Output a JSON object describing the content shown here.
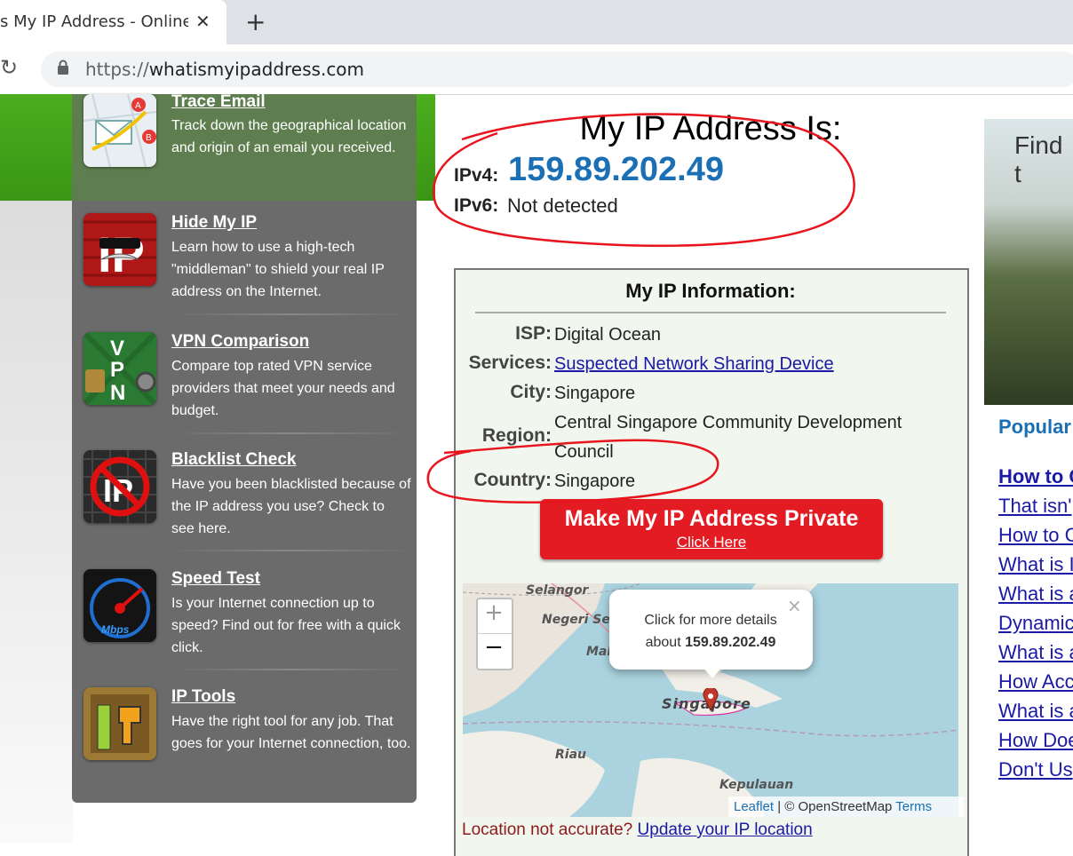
{
  "browser": {
    "tab_title": "s My IP Address - Online P",
    "url_prefix": "https://",
    "url_domain": "whatismyipaddress.com",
    "new_tab_symbol": "+",
    "close_symbol": "✕",
    "reload_symbol": "↻"
  },
  "sidebar": {
    "items": [
      {
        "title": "Trace Email",
        "desc": "Track down the geographical location and origin of an email you received."
      },
      {
        "title": "Hide My IP",
        "desc": "Learn how to use a high-tech \"middleman\" to shield your real IP address on the Internet."
      },
      {
        "title": "VPN Comparison",
        "desc": "Compare top rated VPN service providers that meet your needs and budget."
      },
      {
        "title": "Blacklist Check",
        "desc": "Have you been blacklisted because of the IP address you use? Check to see here."
      },
      {
        "title": "Speed Test",
        "desc": "Is your Internet connection up to speed? Find out for free with a quick click."
      },
      {
        "title": "IP Tools",
        "desc": "Have the right tool for any job. That goes for your Internet connection, too."
      }
    ]
  },
  "main": {
    "title": "My IP Address Is:",
    "ipv4_label": "IPv4:",
    "ipv4_value": "159.89.202.49",
    "ipv6_label": "IPv6:",
    "ipv6_value": "Not detected"
  },
  "info": {
    "title": "My IP Information:",
    "isp_label": "ISP:",
    "isp_value": "Digital Ocean",
    "services_label": "Services:",
    "services_value": "Suspected Network Sharing Device",
    "city_label": "City:",
    "city_value": "Singapore",
    "region_label": "Region:",
    "region_value_line1": "Central Singapore Community Development",
    "region_value_line2": "Council",
    "country_label": "Country:",
    "country_value": "Singapore"
  },
  "private_button": {
    "label": "Make My IP Address Private",
    "sub": "Click Here"
  },
  "map": {
    "zoom_in": "+",
    "zoom_out": "−",
    "popup_line1": "Click for more details",
    "popup_line2_prefix": "about ",
    "popup_ip": "159.89.202.49",
    "popup_close": "×",
    "labels": {
      "selangor": "Selangor",
      "negeri": "Negeri Sem",
      "mal": "Mal",
      "singapore": "Singapore",
      "riau": "Riau",
      "kepulauan": "Kepulauan"
    },
    "attrib_leaflet": "Leaflet",
    "attrib_middle": " | © OpenStreetMap ",
    "attrib_terms": "Terms"
  },
  "location_note": {
    "text": "Location not accurate? ",
    "link": "Update your IP location"
  },
  "ad": {
    "text": "Find t"
  },
  "popular": {
    "title": "Popular",
    "items": [
      "How to C",
      "That isn'",
      "How to C",
      "What is I",
      "What is a",
      "Dynamic",
      "What is a",
      "How Acc",
      "What is a",
      "How Doe",
      "Don't Us"
    ]
  },
  "colors": {
    "ip_blue": "#1a6fb5",
    "cta_red": "#e31b23",
    "annotation_red": "#e8141e",
    "green_band": "#4cae1e"
  }
}
